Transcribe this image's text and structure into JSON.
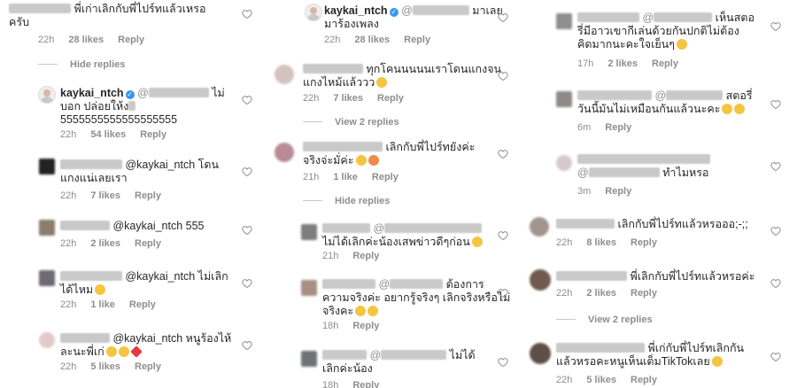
{
  "col1": {
    "c0": {
      "text_l1": "พี่เก่าเลิกกับพี่ไปร์ทแล้วเหรอ",
      "text_l2": "ครับ",
      "time": "22h",
      "likes": "28 likes",
      "reply": "Reply"
    },
    "hide_replies": "Hide replies",
    "c1": {
      "user": "kaykai_ntch",
      "text_l1_end": "ไม่",
      "text_l2": "บอก ปล่อยให้ง",
      "text_l3": "5555555555555555555",
      "time": "22h",
      "likes": "54 likes",
      "reply": "Reply"
    },
    "c2": {
      "mention": "@kaykai_ntch โดน",
      "text_l2": "แกงแน่เลยเรา",
      "time": "22h",
      "likes": "7 likes",
      "reply": "Reply"
    },
    "c3": {
      "mention": "@kaykai_ntch 555",
      "time": "22h",
      "likes": "2 likes",
      "reply": "Reply"
    },
    "c4": {
      "mention": "@kaykai_ntch ไม่เลิก",
      "text_l2": "ได้ไหม",
      "time": "22h",
      "likes": "1 like",
      "reply": "Reply"
    },
    "c5": {
      "mention": "@kaykai_ntch หนูร้องไห้",
      "text_l2": "ละนะพี่เก่",
      "time": "22h",
      "likes": "5 likes",
      "reply": "Reply"
    }
  },
  "col2": {
    "c0": {
      "user": "kaykai_ntch",
      "text_l1_end": "มาเลย",
      "text_l2": "มาร้องเพลง",
      "time": "22h",
      "likes": "28 likes",
      "reply": "Reply"
    },
    "c1": {
      "text_l1": "ทุกโคนนนนนเราโดนแกงจน",
      "text_l2": "แกงไหม้แล้ววว",
      "time": "22h",
      "likes": "7 likes",
      "reply": "Reply"
    },
    "view_replies": "View 2 replies",
    "c2": {
      "text_l1": "เลิกกับพี่ไปร์ทยังค่ะ",
      "text_l2": "จริงจ่ะมั่ค่ะ",
      "time": "21h",
      "likes": "1 like",
      "reply": "Reply"
    },
    "hide_replies": "Hide replies",
    "c3": {
      "text_l2": "ไม่ได้เลิกค่ะน้องเสพข่าวดีๆก่อน",
      "time": "21h",
      "reply": "Reply"
    },
    "c4": {
      "text_l1_end": "ต้องการ",
      "text_l2": "ความจริงค่ะ อยากรู้จริงๆ เลิกจริงหรือไม่",
      "text_l3": "จริงคะ",
      "time": "18h",
      "reply": "Reply"
    },
    "c5": {
      "text_l1_end": "ไม่ได้",
      "text_l2": "เลิกค่ะน้อง",
      "time": "18h",
      "reply": "Reply"
    }
  },
  "col3": {
    "c0": {
      "text_l1_end": "เห็นสตอ",
      "text_l2": "รี่มีอาวเขากีเล่นด้วยกันปกติไม่ต้อง",
      "text_l3": "คิดมากนะคะใจเย็นๆ",
      "time": "17h",
      "likes": "2 likes",
      "reply": "Reply"
    },
    "c1": {
      "text_l1_end": "สตอรี่",
      "text_l2": "วันนี้มันไม่เหมือนกันแล้วนะคะ",
      "time": "6m",
      "reply": "Reply"
    },
    "c2": {
      "text_l2": "ทำไมหรอ",
      "time": "3m",
      "reply": "Reply"
    },
    "c3": {
      "text_l1": "เลิกกับพี่ไปร์ทแล้วหรอออ;-;;",
      "time": "22h",
      "likes": "8 likes",
      "reply": "Reply"
    },
    "c4": {
      "text_l1": "พี่เลิกกับพี่ไปร์ทแล้วหรอค่ะ",
      "time": "22h",
      "likes": "2 likes",
      "reply": "Reply"
    },
    "view_replies": "View 2 replies",
    "c5": {
      "text_l1": "พี่เก่กับพี่ไปร์ทเลิกกัน",
      "text_l2": "แล้วหรอคะหนูเห็นเต็มTikTokเลย",
      "time": "22h",
      "likes": "5 likes",
      "reply": "Reply"
    }
  }
}
